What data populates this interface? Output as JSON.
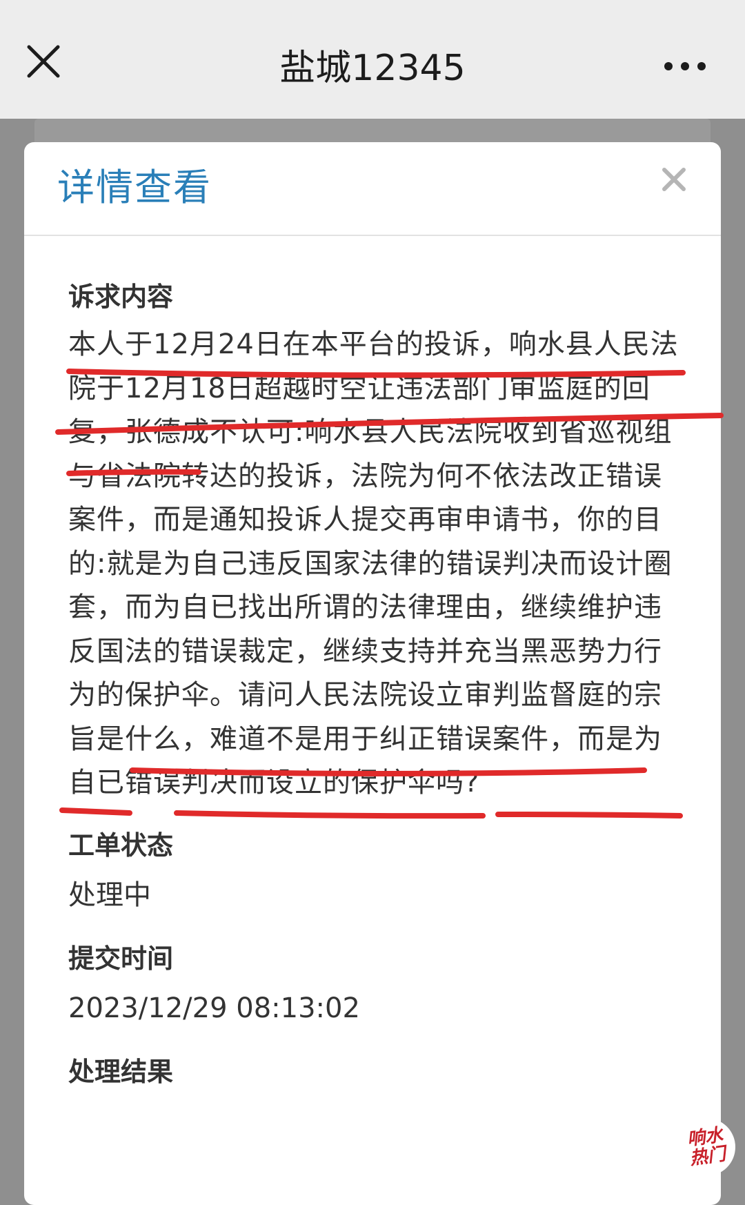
{
  "app_bar": {
    "title": "盐城12345",
    "close_icon": "close-x-icon",
    "more_icon": "more-dots-icon"
  },
  "modal": {
    "title": "详情查看",
    "close_icon": "close-x-icon",
    "sections": {
      "complaint": {
        "label": "诉求内容",
        "text": "本人于12月24日在本平台的投诉，响水县人民法院于12月18日超越时空让违法部门审监庭的回复，张德成不认可:响水县人民法院收到省巡视组与省法院转达的投诉，法院为何不依法改正错误案件，而是通知投诉人提交再审申请书，你的目的:就是为自己违反国家法律的错误判决而设计圈套，而为自已找出所谓的法律理由，继续维护违反国法的错误裁定，继续支持并充当黑恶势力行为的保护伞。请问人民法院设立审判监督庭的宗旨是什么，难道不是用于纠正错误案件，而是为自已错误判决而设立的保护伞吗?"
      },
      "status": {
        "label": "工单状态",
        "value": "处理中"
      },
      "submit_time": {
        "label": "提交时间",
        "value": "2023/12/29 08:13:02"
      },
      "result": {
        "label": "处理结果"
      }
    }
  },
  "watermark": {
    "text_line1": "响水",
    "text_line2": "热门"
  },
  "colors": {
    "title_blue": "#2a7fb8",
    "annotation_red": "#e02a2a",
    "bar_bg": "#ededed",
    "overlay_gray": "#8f8f8f"
  }
}
